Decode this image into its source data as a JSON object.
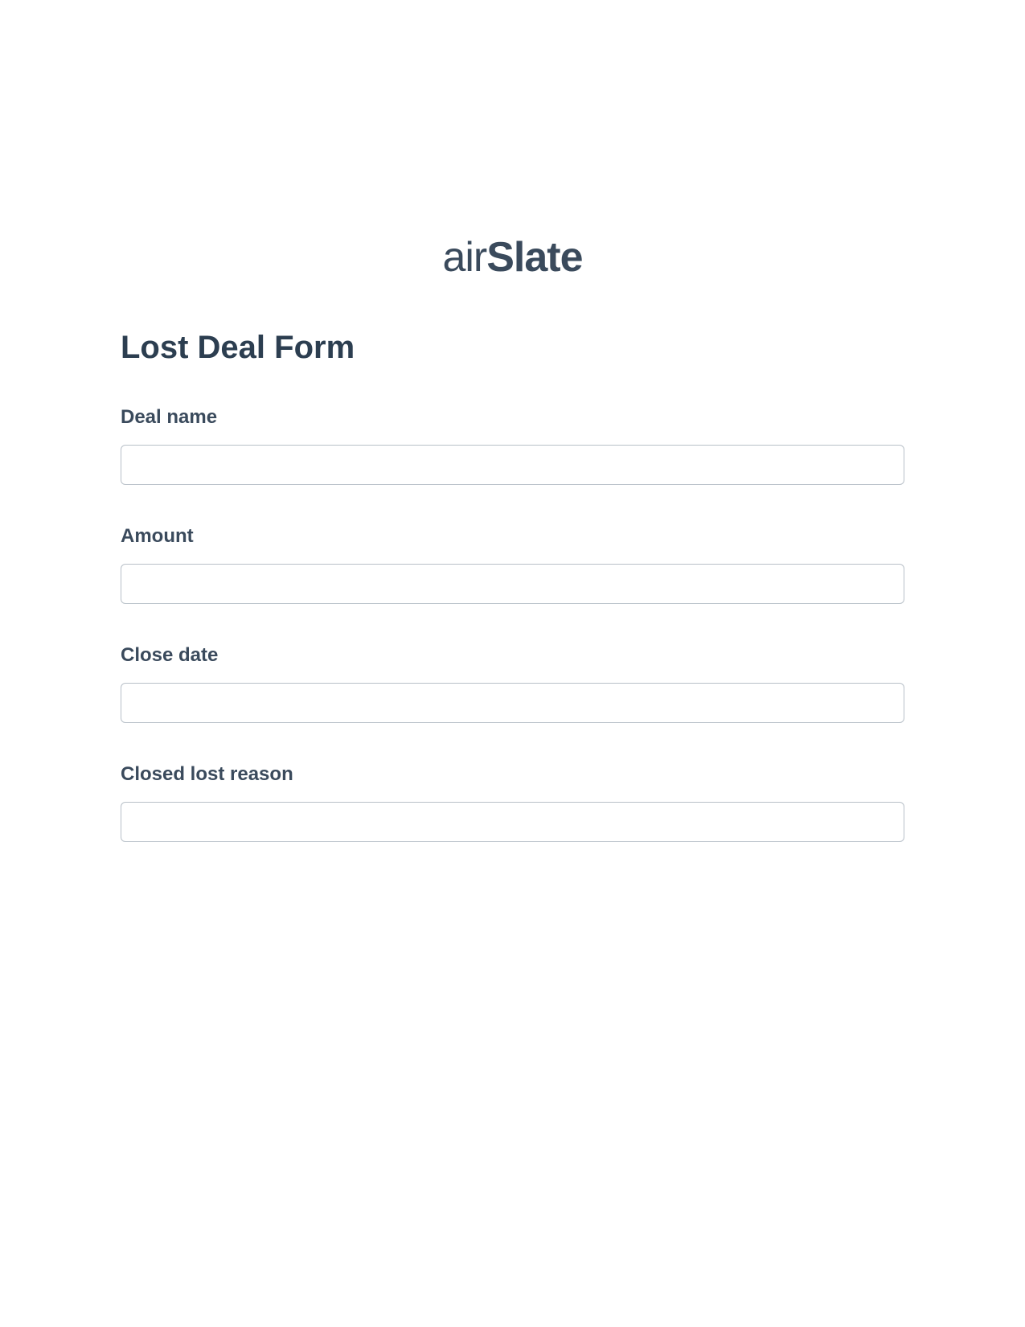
{
  "logo": {
    "text_part1": "air",
    "text_part2": "Slate"
  },
  "form": {
    "title": "Lost Deal Form",
    "fields": [
      {
        "label": "Deal name",
        "value": ""
      },
      {
        "label": "Amount",
        "value": ""
      },
      {
        "label": "Close date",
        "value": ""
      },
      {
        "label": "Closed lost reason",
        "value": ""
      }
    ]
  }
}
